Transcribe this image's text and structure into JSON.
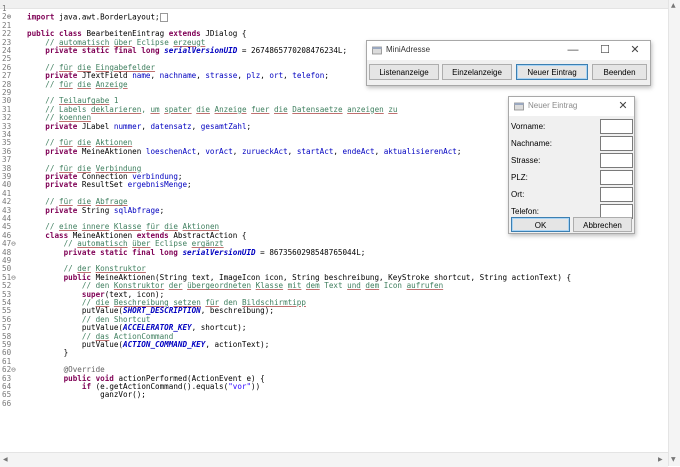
{
  "editor": {
    "lines": [
      {
        "n": "1",
        "tokens": []
      },
      {
        "n": "2⊕",
        "tokens": [
          [
            "k",
            "import"
          ],
          [
            "t",
            " java.awt.BorderLayout;"
          ],
          [
            "box",
            ""
          ]
        ]
      },
      {
        "n": "21",
        "tokens": []
      },
      {
        "n": "22",
        "tokens": [
          [
            "k",
            "public class"
          ],
          [
            "t",
            " BearbeitenEintrag "
          ],
          [
            "k",
            "extends"
          ],
          [
            "t",
            " JDialog {"
          ]
        ]
      },
      {
        "n": "23",
        "tokens": [
          [
            "t",
            "    "
          ],
          [
            "c",
            "// "
          ],
          [
            "cu",
            "automatisch"
          ],
          [
            "c",
            " "
          ],
          [
            "cu",
            "über"
          ],
          [
            "c",
            " Eclipse "
          ],
          [
            "cu",
            "erzeugt"
          ]
        ]
      },
      {
        "n": "24",
        "tokens": [
          [
            "t",
            "    "
          ],
          [
            "k",
            "private static final long"
          ],
          [
            "t",
            " "
          ],
          [
            "sf",
            "serialVersionUID"
          ],
          [
            "t",
            " = 2674865770208476234L;"
          ]
        ]
      },
      {
        "n": "25",
        "tokens": []
      },
      {
        "n": "26",
        "tokens": [
          [
            "t",
            "    "
          ],
          [
            "c",
            "// "
          ],
          [
            "cu",
            "für"
          ],
          [
            "c",
            " "
          ],
          [
            "cu",
            "die"
          ],
          [
            "c",
            " "
          ],
          [
            "cu",
            "Eingabefelder"
          ]
        ]
      },
      {
        "n": "27",
        "tokens": [
          [
            "t",
            "    "
          ],
          [
            "k",
            "private"
          ],
          [
            "t",
            " JTextField "
          ],
          [
            "f",
            "name"
          ],
          [
            "t",
            ", "
          ],
          [
            "f",
            "nachname"
          ],
          [
            "t",
            ", "
          ],
          [
            "f",
            "strasse"
          ],
          [
            "t",
            ", "
          ],
          [
            "f",
            "plz"
          ],
          [
            "t",
            ", "
          ],
          [
            "f",
            "ort"
          ],
          [
            "t",
            ", "
          ],
          [
            "f",
            "telefon"
          ],
          [
            "t",
            ";"
          ]
        ]
      },
      {
        "n": "28",
        "tokens": [
          [
            "t",
            "    "
          ],
          [
            "c",
            "// "
          ],
          [
            "cu",
            "für"
          ],
          [
            "c",
            " "
          ],
          [
            "cu",
            "die"
          ],
          [
            "c",
            " "
          ],
          [
            "cu",
            "Anzeige"
          ]
        ]
      },
      {
        "n": "29",
        "tokens": []
      },
      {
        "n": "30",
        "tokens": [
          [
            "t",
            "    "
          ],
          [
            "c",
            "// "
          ],
          [
            "cu",
            "Teilaufgabe"
          ],
          [
            "c",
            " 1"
          ]
        ]
      },
      {
        "n": "31",
        "tokens": [
          [
            "t",
            "    "
          ],
          [
            "c",
            "// Labels "
          ],
          [
            "cu",
            "deklarieren"
          ],
          [
            "c",
            ", "
          ],
          [
            "cu",
            "um"
          ],
          [
            "c",
            " "
          ],
          [
            "cu",
            "spater"
          ],
          [
            "c",
            " "
          ],
          [
            "cu",
            "die"
          ],
          [
            "c",
            " "
          ],
          [
            "cu",
            "Anzeige"
          ],
          [
            "c",
            " "
          ],
          [
            "cu",
            "fuer"
          ],
          [
            "c",
            " "
          ],
          [
            "cu",
            "die"
          ],
          [
            "c",
            " "
          ],
          [
            "cu",
            "Datensaetze"
          ],
          [
            "c",
            " "
          ],
          [
            "cu",
            "anzeigen"
          ],
          [
            "c",
            " "
          ],
          [
            "cu",
            "zu"
          ]
        ]
      },
      {
        "n": "32",
        "tokens": [
          [
            "t",
            "    "
          ],
          [
            "c",
            "// "
          ],
          [
            "cu",
            "koennen"
          ]
        ]
      },
      {
        "n": "33",
        "tokens": [
          [
            "t",
            "    "
          ],
          [
            "k",
            "private"
          ],
          [
            "t",
            " JLabel "
          ],
          [
            "f",
            "nummer"
          ],
          [
            "t",
            ", "
          ],
          [
            "f",
            "datensatz"
          ],
          [
            "t",
            ", "
          ],
          [
            "f",
            "gesamtZahl"
          ],
          [
            "t",
            ";"
          ]
        ]
      },
      {
        "n": "34",
        "tokens": []
      },
      {
        "n": "35",
        "tokens": [
          [
            "t",
            "    "
          ],
          [
            "c",
            "// "
          ],
          [
            "cu",
            "für"
          ],
          [
            "c",
            " "
          ],
          [
            "cu",
            "die"
          ],
          [
            "c",
            " "
          ],
          [
            "cu",
            "Aktionen"
          ]
        ]
      },
      {
        "n": "36",
        "tokens": [
          [
            "t",
            "    "
          ],
          [
            "k",
            "private"
          ],
          [
            "t",
            " MeineAktionen "
          ],
          [
            "f",
            "loeschenAct"
          ],
          [
            "t",
            ", "
          ],
          [
            "f",
            "vorAct"
          ],
          [
            "t",
            ", "
          ],
          [
            "f",
            "zurueckAct"
          ],
          [
            "t",
            ", "
          ],
          [
            "f",
            "startAct"
          ],
          [
            "t",
            ", "
          ],
          [
            "f",
            "endeAct"
          ],
          [
            "t",
            ", "
          ],
          [
            "f",
            "aktualisierenAct"
          ],
          [
            "t",
            ";"
          ]
        ]
      },
      {
        "n": "37",
        "tokens": []
      },
      {
        "n": "38",
        "tokens": [
          [
            "t",
            "    "
          ],
          [
            "c",
            "// "
          ],
          [
            "cu",
            "für"
          ],
          [
            "c",
            " "
          ],
          [
            "cu",
            "die"
          ],
          [
            "c",
            " "
          ],
          [
            "cu",
            "Verbindung"
          ]
        ]
      },
      {
        "n": "39",
        "tokens": [
          [
            "t",
            "    "
          ],
          [
            "k",
            "private"
          ],
          [
            "t",
            " Connection "
          ],
          [
            "f",
            "verbindung"
          ],
          [
            "t",
            ";"
          ]
        ]
      },
      {
        "n": "40",
        "tokens": [
          [
            "t",
            "    "
          ],
          [
            "k",
            "private"
          ],
          [
            "t",
            " ResultSet "
          ],
          [
            "f",
            "ergebnisMenge"
          ],
          [
            "t",
            ";"
          ]
        ]
      },
      {
        "n": "41",
        "tokens": []
      },
      {
        "n": "42",
        "tokens": [
          [
            "t",
            "    "
          ],
          [
            "c",
            "// "
          ],
          [
            "cu",
            "für"
          ],
          [
            "c",
            " "
          ],
          [
            "cu",
            "die"
          ],
          [
            "c",
            " "
          ],
          [
            "cu",
            "Abfrage"
          ]
        ]
      },
      {
        "n": "43",
        "tokens": [
          [
            "t",
            "    "
          ],
          [
            "k",
            "private"
          ],
          [
            "t",
            " String "
          ],
          [
            "f",
            "sqlAbfrage"
          ],
          [
            "t",
            ";"
          ]
        ]
      },
      {
        "n": "44",
        "tokens": []
      },
      {
        "n": "45",
        "tokens": [
          [
            "t",
            "    "
          ],
          [
            "c",
            "// "
          ],
          [
            "cu",
            "eine"
          ],
          [
            "c",
            " "
          ],
          [
            "cu",
            "innere"
          ],
          [
            "c",
            " "
          ],
          [
            "cu",
            "Klasse"
          ],
          [
            "c",
            " "
          ],
          [
            "cu",
            "für"
          ],
          [
            "c",
            " "
          ],
          [
            "cu",
            "die"
          ],
          [
            "c",
            " "
          ],
          [
            "cu",
            "Aktionen"
          ]
        ]
      },
      {
        "n": "46",
        "tokens": [
          [
            "t",
            "    "
          ],
          [
            "k",
            "class"
          ],
          [
            "t",
            " MeineAktionen "
          ],
          [
            "k",
            "extends"
          ],
          [
            "t",
            " AbstractAction {"
          ]
        ]
      },
      {
        "n": "47⊖",
        "tokens": [
          [
            "t",
            "        "
          ],
          [
            "c",
            "// "
          ],
          [
            "cu",
            "automatisch"
          ],
          [
            "c",
            " "
          ],
          [
            "cu",
            "über"
          ],
          [
            "c",
            " Eclipse "
          ],
          [
            "cu",
            "ergänzt"
          ]
        ]
      },
      {
        "n": "48",
        "tokens": [
          [
            "t",
            "        "
          ],
          [
            "k",
            "private static final long"
          ],
          [
            "t",
            " "
          ],
          [
            "sf",
            "serialVersionUID"
          ],
          [
            "t",
            " = 8673560298548765044L;"
          ]
        ]
      },
      {
        "n": "49",
        "tokens": []
      },
      {
        "n": "50",
        "tokens": [
          [
            "t",
            "        "
          ],
          [
            "c",
            "// "
          ],
          [
            "cu",
            "der"
          ],
          [
            "c",
            " "
          ],
          [
            "cu",
            "Konstruktor"
          ]
        ]
      },
      {
        "n": "51⊖",
        "tokens": [
          [
            "t",
            "        "
          ],
          [
            "k",
            "public"
          ],
          [
            "t",
            " MeineAktionen(String text, ImageIcon icon, String beschreibung, KeyStroke shortcut, String actionText) {"
          ]
        ]
      },
      {
        "n": "52",
        "tokens": [
          [
            "t",
            "            "
          ],
          [
            "c",
            "// den "
          ],
          [
            "cu",
            "Konstruktor"
          ],
          [
            "c",
            " "
          ],
          [
            "cu",
            "der"
          ],
          [
            "c",
            " "
          ],
          [
            "cu",
            "übergeordneten"
          ],
          [
            "c",
            " "
          ],
          [
            "cu",
            "Klasse"
          ],
          [
            "c",
            " "
          ],
          [
            "cu",
            "mit"
          ],
          [
            "c",
            " "
          ],
          [
            "cu",
            "dem"
          ],
          [
            "c",
            " Text "
          ],
          [
            "cu",
            "und"
          ],
          [
            "c",
            " "
          ],
          [
            "cu",
            "dem"
          ],
          [
            "c",
            " Icon "
          ],
          [
            "cu",
            "aufrufen"
          ]
        ]
      },
      {
        "n": "53",
        "tokens": [
          [
            "t",
            "            "
          ],
          [
            "k",
            "super"
          ],
          [
            "t",
            "(text, icon);"
          ]
        ]
      },
      {
        "n": "54",
        "tokens": [
          [
            "t",
            "            "
          ],
          [
            "c",
            "// "
          ],
          [
            "cu",
            "die"
          ],
          [
            "c",
            " "
          ],
          [
            "cu",
            "Beschreibung"
          ],
          [
            "c",
            " "
          ],
          [
            "cu",
            "setzen"
          ],
          [
            "c",
            " "
          ],
          [
            "cu",
            "für"
          ],
          [
            "c",
            " den "
          ],
          [
            "cu",
            "Bildschirmtipp"
          ]
        ]
      },
      {
        "n": "55",
        "tokens": [
          [
            "t",
            "            putValue("
          ],
          [
            "sf",
            "SHORT_DESCRIPTION"
          ],
          [
            "t",
            ", beschreibung);"
          ]
        ]
      },
      {
        "n": "56",
        "tokens": [
          [
            "t",
            "            "
          ],
          [
            "c",
            "// den Shortcut"
          ]
        ]
      },
      {
        "n": "57",
        "tokens": [
          [
            "t",
            "            putValue("
          ],
          [
            "sf",
            "ACCELERATOR_KEY"
          ],
          [
            "t",
            ", shortcut);"
          ]
        ]
      },
      {
        "n": "58",
        "tokens": [
          [
            "t",
            "            "
          ],
          [
            "c",
            "// "
          ],
          [
            "cu",
            "das"
          ],
          [
            "c",
            " ActionCommand"
          ]
        ]
      },
      {
        "n": "59",
        "tokens": [
          [
            "t",
            "            putValue("
          ],
          [
            "sf",
            "ACTION_COMMAND_KEY"
          ],
          [
            "t",
            ", actionText);"
          ]
        ]
      },
      {
        "n": "60",
        "tokens": [
          [
            "t",
            "        }"
          ]
        ]
      },
      {
        "n": "61",
        "tokens": []
      },
      {
        "n": "62⊖",
        "tokens": [
          [
            "t",
            "        "
          ],
          [
            "a",
            "@Override"
          ]
        ]
      },
      {
        "n": "63",
        "tokens": [
          [
            "t",
            "        "
          ],
          [
            "k",
            "public void"
          ],
          [
            "t",
            " actionPerformed(ActionEvent e) {"
          ]
        ]
      },
      {
        "n": "64",
        "tokens": [
          [
            "t",
            "            "
          ],
          [
            "k",
            "if"
          ],
          [
            "t",
            " (e.getActionCommand().equals("
          ],
          [
            "s",
            "\"vor\""
          ],
          [
            "t",
            "))"
          ]
        ]
      },
      {
        "n": "65",
        "tokens": [
          [
            "t",
            "                ganzVor();"
          ]
        ]
      },
      {
        "n": "66",
        "tokens": []
      }
    ]
  },
  "mini_window": {
    "title": "MiniAdresse",
    "buttons": [
      "Listenanzeige",
      "Einzelanzeige",
      "Neuer Eintrag",
      "Beenden"
    ],
    "controls": {
      "minimize": "—",
      "maximize": "☐",
      "close": "✕"
    }
  },
  "dialog": {
    "title": "Neuer Eintrag",
    "close": "✕",
    "fields": [
      "Vorname:",
      "Nachname:",
      "Strasse:",
      "PLZ:",
      "Ort:",
      "Telefon:"
    ],
    "ok_label": "OK",
    "cancel_label": "Abbrechen"
  },
  "scroll": {
    "up": "▲",
    "down": "▼",
    "left": "◀",
    "right": "▶"
  }
}
